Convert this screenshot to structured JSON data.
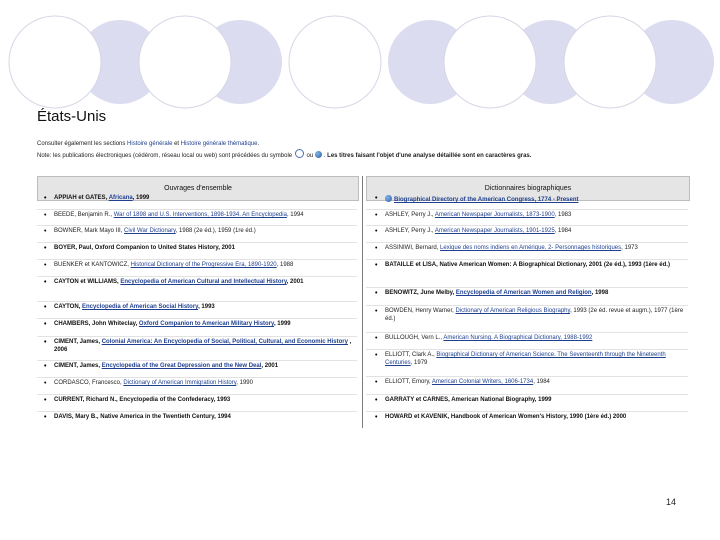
{
  "page": {
    "title": "États-Unis",
    "page_number": "14"
  },
  "intro": {
    "line1_prefix": "Consulter également les sections ",
    "line1_link1": "Histoire générale",
    "line1_mid": " et ",
    "line1_link2": "Histoire générale thématique",
    "line1_suffix": ".",
    "line2_prefix": "Note: les publications électroniques (cédérom, réseau local ou web) sont précédées du symbole ",
    "line2_mid": " ou ",
    "line2_bold": "Les titres faisant l'objet d'une analyse détaillée sont en caractères gras."
  },
  "table": {
    "left_header": "Ouvrages d'ensemble",
    "right_header": "Dictionnaires biographiques",
    "left": [
      {
        "pre": "APPIAH et GATES, ",
        "link": "Africana",
        "post": ", 1999",
        "bold": true
      },
      {
        "pre": "BEEDE, Benjamin R., ",
        "link": "War of 1898 and U.S. Interventions, 1898-1934. An Encyclopedia",
        "post": ", 1994",
        "bold": false
      },
      {
        "pre": "BOWNER, Mark Mayo III, ",
        "link": "Civil War Dictionary",
        "post": ", 1988 (2e éd.), 1959 (1re éd.)",
        "bold": false
      },
      {
        "pre": "BOYER, Paul, Oxford Companion to United States History, 2001",
        "link": "",
        "post": "",
        "bold": true
      },
      {
        "pre": "BUENKER et KANTOWICZ, ",
        "link": "Historical Dictionary of the Progressive Era, 1890-1920",
        "post": ", 1988",
        "bold": false
      },
      {
        "pre": "CAYTON et WILLIAMS, ",
        "link": "Encyclopedia of American Cultural and Intellectual History",
        "post": ", 2001",
        "bold": true
      },
      {
        "pre": "CAYTON, ",
        "link": "Encyclopedia of American Social History",
        "post": ", 1993",
        "bold": true
      },
      {
        "pre": "CHAMBERS, John Whiteclay, ",
        "link": "Oxford Companion to American Military History",
        "post": ", 1999",
        "bold": true
      },
      {
        "pre": "CIMENT, James, ",
        "link": "Colonial America: An Encyclopedia of Social, Political, Cultural, and Economic History",
        "post": " , 2006",
        "bold": true
      },
      {
        "pre": "CIMENT, James, ",
        "link": "Encyclopedia of the Great Depression and the New Deal",
        "post": ", 2001",
        "bold": true
      },
      {
        "pre": "CORDASCO, Francesco, ",
        "link": "Dictionary of American Immigration History",
        "post": ", 1990",
        "bold": false
      },
      {
        "pre": "CURRENT, Richard N., Encyclopedia of the Confederacy, 1993",
        "link": "",
        "post": "",
        "bold": true
      },
      {
        "pre": "DAVIS, Mary B., Native America in the Twentieth Century, 1994",
        "link": "",
        "post": "",
        "bold": true
      }
    ],
    "right": [
      {
        "pre": "",
        "link": "Biographical Directory of the American Congress, 1774 - Present",
        "post": "",
        "bold": true,
        "globe": true
      },
      {
        "pre": "ASHLEY, Perry J., ",
        "link": "American Newspaper Journalists, 1873-1900",
        "post": ", 1983",
        "bold": false,
        "globe": false
      },
      {
        "pre": "ASHLEY, Perry J., ",
        "link": "American Newspaper Journalists, 1901-1925",
        "post": ", 1984",
        "bold": false,
        "globe": false
      },
      {
        "pre": "ASSINIWI, Bernard, ",
        "link": "Lexique des noms indiens en Amérique. 2- Personnages historiques",
        "post": ", 1973",
        "bold": false,
        "globe": false
      },
      {
        "pre": "BATAILLE et LISA, Native American Women: A Biographical Dictionary, 2001 (2e éd.), 1993 (1ère éd.)",
        "link": "",
        "post": "",
        "bold": true,
        "globe": false
      },
      {
        "pre": "BENOWITZ, June Melby, ",
        "link": "Encyclopedia of American Women and Religion",
        "post": ", 1998",
        "bold": true,
        "globe": false
      },
      {
        "pre": "BOWDEN, Henry Warner, ",
        "link": "Dictionary of American Religious Biography",
        "post": ", 1993 (2e éd. revue et augm.), 1977 (1ère éd.)",
        "bold": false,
        "globe": false
      },
      {
        "pre": "BULLOUGH, Vern L., ",
        "link": "American Nursing. A Biographical Dictionary, 1988-1992",
        "post": "",
        "bold": false,
        "globe": false
      },
      {
        "pre": "ELLIOTT, Clark A., ",
        "link": "Biographical Dictionary of American Science. The Seventeenth through the Nineteenth Centuries",
        "post": ", 1979",
        "bold": false,
        "globe": false
      },
      {
        "pre": "ELLIOTT, Emory, ",
        "link": "American Colonial Writers, 1606-1734",
        "post": ", 1984",
        "bold": false,
        "globe": false
      },
      {
        "pre": "GARRATY et CARNES, American National Biography, 1999",
        "link": "",
        "post": "",
        "bold": true,
        "globe": false
      },
      {
        "pre": "HOWARD et KAVENIK, Handbook of American Women's History, 1990 (1ère éd.) 2000",
        "link": "",
        "post": "",
        "bold": true,
        "globe": false
      }
    ]
  }
}
